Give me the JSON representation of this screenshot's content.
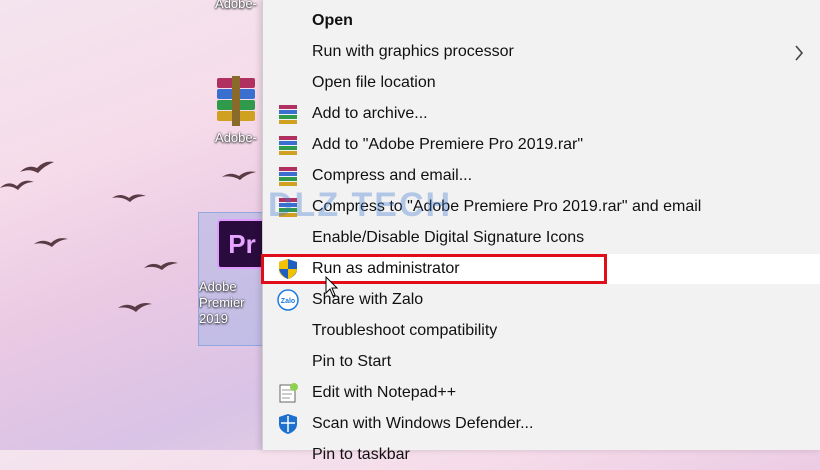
{
  "desktop": {
    "icons": [
      {
        "label": "Adobe-"
      },
      {
        "label": "Adobe-"
      },
      {
        "label": "Adobe\nPremier\n2019",
        "logo": "Pr"
      }
    ]
  },
  "context_menu": {
    "items": [
      {
        "label": "Open",
        "icon": "none"
      },
      {
        "label": "Run with graphics processor",
        "icon": "none",
        "submenu": "chevron-right-icon"
      },
      {
        "label": "Open file location",
        "icon": "none"
      },
      {
        "label": "Add to archive...",
        "icon": "winrar-icon"
      },
      {
        "label": "Add to \"Adobe Premiere Pro 2019.rar\"",
        "icon": "winrar-icon"
      },
      {
        "label": "Compress and email...",
        "icon": "winrar-icon"
      },
      {
        "label": "Compress to \"Adobe Premiere Pro 2019.rar\" and email",
        "icon": "winrar-icon"
      },
      {
        "label": "Enable/Disable Digital Signature Icons",
        "icon": "none"
      },
      {
        "label": "Run as administrator",
        "icon": "uac-shield-icon"
      },
      {
        "label": "Share with Zalo",
        "icon": "zalo-icon"
      },
      {
        "label": "Troubleshoot compatibility",
        "icon": "none"
      },
      {
        "label": "Pin to Start",
        "icon": "none"
      },
      {
        "label": "Edit with Notepad++",
        "icon": "notepad-plus-plus-icon"
      },
      {
        "label": "Scan with Windows Defender...",
        "icon": "windows-defender-icon"
      },
      {
        "label": "Pin to taskbar",
        "icon": "none"
      }
    ]
  },
  "watermark": "DLZ TECH",
  "colors": {
    "menu_bg": "#f2f2f2",
    "highlight": "#e10e1a",
    "accent_uac": "#1f5fbf"
  }
}
